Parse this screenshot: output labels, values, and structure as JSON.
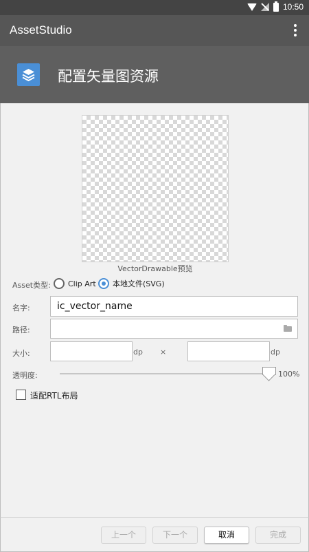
{
  "statusbar": {
    "time": "10:50"
  },
  "appbar": {
    "title": "AssetStudio"
  },
  "header": {
    "title": "配置矢量图资源",
    "icon": "layers-icon",
    "icon_color": "#4a8fd6"
  },
  "preview": {
    "caption": "VectorDrawable预览"
  },
  "asset_type": {
    "label": "Asset类型:",
    "options": [
      {
        "label": "Clip Art",
        "selected": false
      },
      {
        "label": "本地文件(SVG)",
        "selected": true
      }
    ]
  },
  "name": {
    "label": "名字:",
    "value": "ic_vector_name"
  },
  "path": {
    "label": "路径:",
    "value": ""
  },
  "size": {
    "label": "大小:",
    "unit": "dp",
    "separator": "×",
    "width": "",
    "height": ""
  },
  "opacity": {
    "label": "透明度:",
    "value_text": "100%",
    "value": 100
  },
  "rtl": {
    "label": "适配RTL布局",
    "checked": false
  },
  "footer": {
    "prev": "上一个",
    "next": "下一个",
    "cancel": "取消",
    "finish": "完成"
  }
}
